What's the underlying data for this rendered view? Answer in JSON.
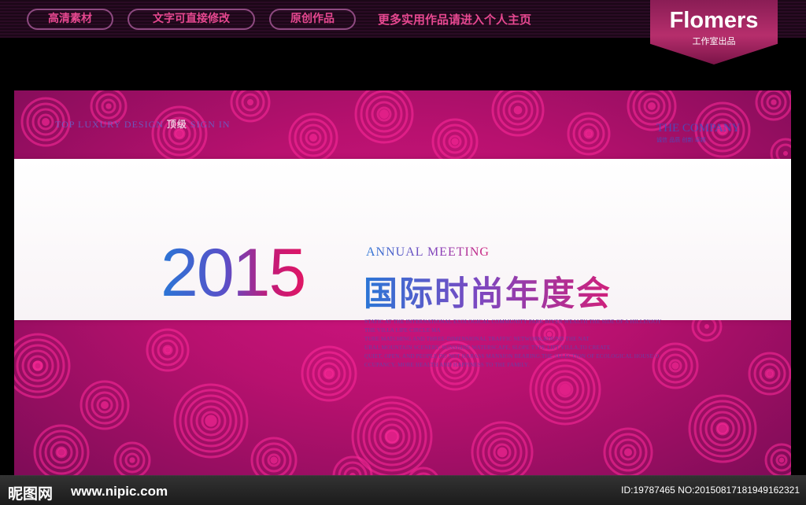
{
  "top_bar": {
    "pills": [
      "高清素材",
      "文字可直接修改",
      "原创作品"
    ],
    "promo_text": "更多实用作品请进入个人主页"
  },
  "badge": {
    "title": "Flomers",
    "subtitle": "工作室出品"
  },
  "banner": {
    "logo_left_prefix": "TOP LUXURY DESIGN",
    "logo_left_highlight": "顶级",
    "logo_left_suffix": "SIGN IN",
    "logo_right": "THE COMPANY",
    "logo_right_sub": "诚信 品质 创新 卓越",
    "year": "2015",
    "annual": "ANNUAL  MEETING",
    "title_zh": "国际时尚年度会",
    "description_lines": [
      "STATIC AT THE INTERNATIONAL ECOLOGICAL COMMUNITY PARK RIVER WEALTH THE SIDE OF A HILLENJOY",
      "THE VILLA LIFE CIRCLE MA",
      "TURE MATCHING AND THREE-DIMENSIONAL TRAFFIC NETWORK,ROUND THE NAT",
      "URAL MOUNTAIN SCENERY, SUNSHINE WATERSCAPE, SLOPE TYPE LIFT VILLA,TO CREATE",
      "QUIET, OPEN, AND PEOPLE DO NOT HARASS MANSION BEARING.THE SELECTION OF ECOLOGICAL HOUSE O",
      "CCUPANCY, MORE HEALTH AND HAPPINESS TO THE FAMILY."
    ]
  },
  "watermark": {
    "site_logo": "昵图网",
    "url": "www.nipic.com",
    "id_text": "ID:19787465 NO:20150817181949162321"
  },
  "colors": {
    "magenta": "#d41583",
    "deep_magenta": "#7e0c57",
    "ring": "#ff2a9a",
    "blue": "#2a76d6",
    "pink_text": "#e64890"
  }
}
